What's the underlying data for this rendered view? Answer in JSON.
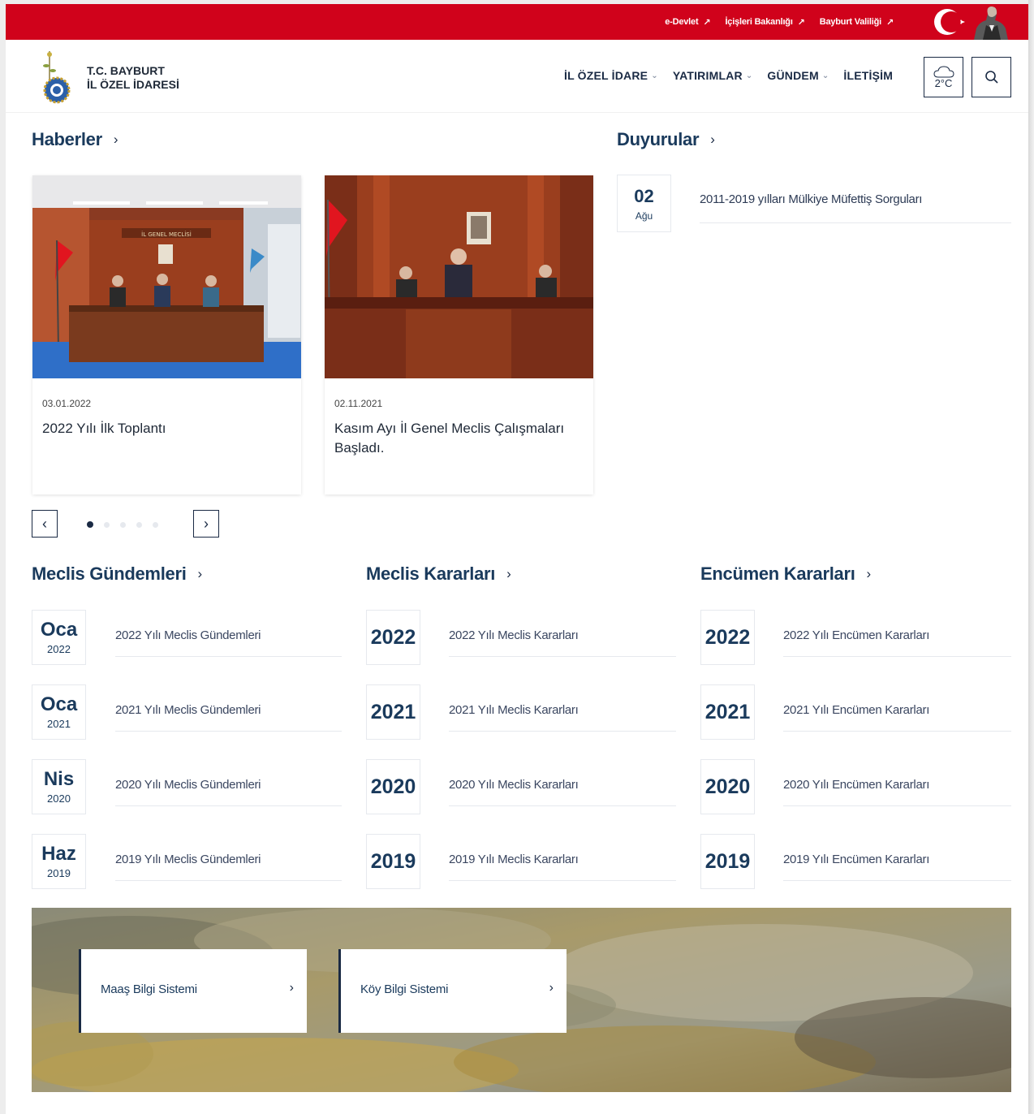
{
  "topbar": {
    "links": [
      {
        "label": "e-Devlet",
        "icon": "external-arrow-icon"
      },
      {
        "label": "İçişleri Bakanlığı",
        "icon": "external-arrow-icon"
      },
      {
        "label": "Bayburt Valiliği",
        "icon": "external-arrow-icon"
      }
    ],
    "arrow_glyph": "↗",
    "color": "#d0021b"
  },
  "header": {
    "brand_line1": "T.C. BAYBURT",
    "brand_line2": "İL ÖZEL İDARESİ",
    "nav": [
      {
        "label": "İL ÖZEL İDARE",
        "has_dropdown": true
      },
      {
        "label": "YATIRIMLAR",
        "has_dropdown": true
      },
      {
        "label": "GÜNDEM",
        "has_dropdown": true
      },
      {
        "label": "İLETİŞİM",
        "has_dropdown": false
      }
    ],
    "weather": {
      "temp": "2°C",
      "icon": "cloud-icon"
    },
    "search_icon": "search-icon"
  },
  "news": {
    "title": "Haberler",
    "items": [
      {
        "date": "03.01.2022",
        "title": "2022 Yılı İlk Toplantı",
        "image_caption": "İL GENEL MECLİSİ"
      },
      {
        "date": "02.11.2021",
        "title": "Kasım Ayı İl Genel Meclis Çalışmaları Başladı."
      }
    ],
    "dots": 5,
    "active_dot": 0
  },
  "announcements": {
    "title": "Duyurular",
    "items": [
      {
        "day": "02",
        "month": "Ağu",
        "text": "2011-2019 yılları Mülkiye Müfettiş Sorguları"
      }
    ]
  },
  "meclis_gundemleri": {
    "title": "Meclis Gündemleri",
    "items": [
      {
        "month": "Oca",
        "year": "2022",
        "text": "2022 Yılı Meclis Gündemleri"
      },
      {
        "month": "Oca",
        "year": "2021",
        "text": "2021 Yılı Meclis Gündemleri"
      },
      {
        "month": "Nis",
        "year": "2020",
        "text": "2020 Yılı Meclis Gündemleri"
      },
      {
        "month": "Haz",
        "year": "2019",
        "text": "2019 Yılı Meclis Gündemleri"
      }
    ]
  },
  "meclis_kararlari": {
    "title": "Meclis Kararları",
    "items": [
      {
        "year": "2022",
        "text": "2022 Yılı Meclis Kararları"
      },
      {
        "year": "2021",
        "text": "2021 Yılı Meclis Kararları"
      },
      {
        "year": "2020",
        "text": "2020 Yılı Meclis Kararları"
      },
      {
        "year": "2019",
        "text": "2019 Yılı Meclis Kararları"
      }
    ]
  },
  "encumen_kararlari": {
    "title": "Encümen Kararları",
    "items": [
      {
        "year": "2022",
        "text": "2022 Yılı Encümen Kararları"
      },
      {
        "year": "2021",
        "text": "2021 Yılı Encümen Kararları"
      },
      {
        "year": "2020",
        "text": "2020 Yılı Encümen Kararları"
      },
      {
        "year": "2019",
        "text": "2019 Yılı Encümen Kararları"
      }
    ]
  },
  "banner": {
    "buttons": [
      {
        "label": "Maaş Bilgi Sistemi"
      },
      {
        "label": "Köy Bilgi Sistemi"
      }
    ]
  },
  "glyphs": {
    "chevron_right": "›",
    "chevron_down": "⌄",
    "prev": "‹",
    "next": "›"
  }
}
